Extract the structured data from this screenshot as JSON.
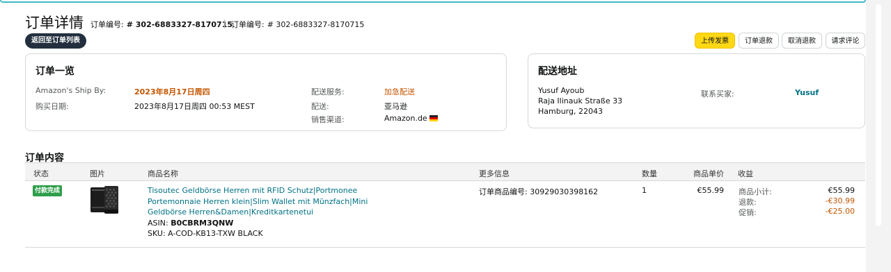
{
  "header": {
    "title": "订单详情",
    "order_label_1": "订单编号:",
    "order_number_1": "# 302-6883327-8170715",
    "order_label_2": "订单编号:",
    "order_number_2": "# 302-6883327-8170715",
    "back_button": "返回至订单列表"
  },
  "actions": {
    "upload_invoice": "上传发票",
    "order_refund": "订单退款",
    "cancel_refund": "取消退款",
    "request_review": "请求评论"
  },
  "summary": {
    "title": "订单一览",
    "ship_by_label": "Amazon's Ship By:",
    "ship_by_value": "2023年8月17日周四",
    "purchase_date_label": "购买日期:",
    "purchase_date_value": "2023年8月17日周四 00:53 MEST",
    "shipping_service_label": "配送服务:",
    "shipping_service_value": "加急配送",
    "fulfillment_label": "配送:",
    "fulfillment_value": "亚马逊",
    "channel_label": "销售渠道:",
    "channel_value": "Amazon.de"
  },
  "address": {
    "title": "配送地址",
    "name": "Yusuf Ayoub",
    "street": "Raja Ilinauk Straße 33",
    "city": "Hamburg, 22043",
    "contact_label": "联系买家:",
    "contact_value": "Yusuf"
  },
  "contents": {
    "title": "订单内容",
    "columns": [
      "状态",
      "图片",
      "商品名称",
      "更多信息",
      "数量",
      "商品单价",
      "收益"
    ],
    "row": {
      "status": "付款完成",
      "product_name": "Tisoutec Geldbörse Herren mit RFID Schutz|Portmonee Portemonnaie Herren klein|Slim Wallet mit Münzfach|Mini Geldbörse Herren&Damen|Kreditkartenetui",
      "asin_label": "ASIN:",
      "asin": "B0CBRM3QNW",
      "sku": "SKU: A-COD-KB13-TXW BLACK",
      "more_info": "订单商品编号: 30929030398162",
      "quantity": "1",
      "unit_price": "€55.99",
      "subtotal_label": "商品小计:",
      "subtotal": "€55.99",
      "refund_label": "退款:",
      "refund": "-€30.99",
      "promo_label": "促销:",
      "promo": "-€25.00"
    }
  },
  "colors": {
    "accent_teal": "#007185",
    "accent_orange": "#c45500",
    "button_yellow": "#ffd814",
    "status_green": "#2e9e4a"
  }
}
